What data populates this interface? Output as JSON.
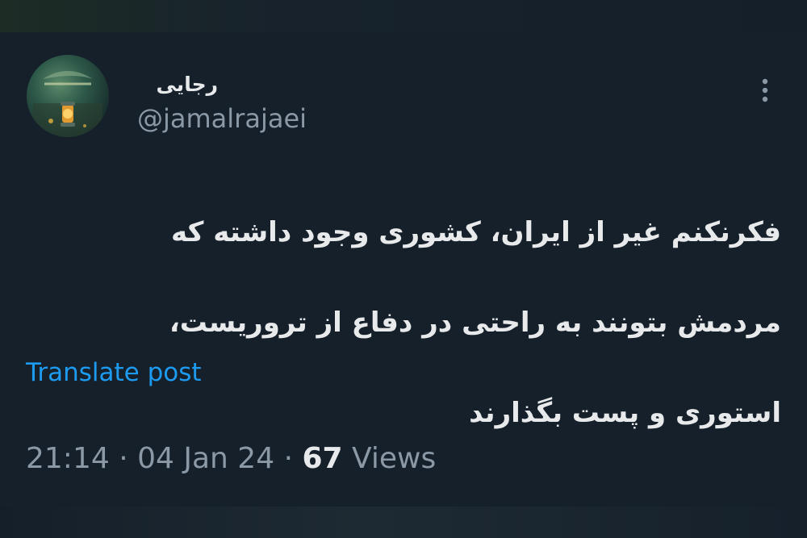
{
  "tweet": {
    "author": {
      "display_name": "رجایی",
      "handle": "@jamalrajaei",
      "avatar_icon": "lantern-avatar-image"
    },
    "text_lines": [
      "فکرنکنم غیر از ایران، کشوری وجود داشته که",
      "مردمش بتونند به راحتی در دفاع از تروریست،",
      "استوری و پست بگذارند"
    ],
    "translate_label": "Translate post",
    "time": "21:14",
    "date": "04 Jan 24",
    "separator": "·",
    "views_count": "67",
    "views_label": "Views",
    "more_icon": "more-vertical-icon"
  },
  "colors": {
    "background": "#15202b",
    "primary_text": "#e7e9ea",
    "secondary_text": "#8b98a5",
    "link": "#1d9bf0"
  }
}
